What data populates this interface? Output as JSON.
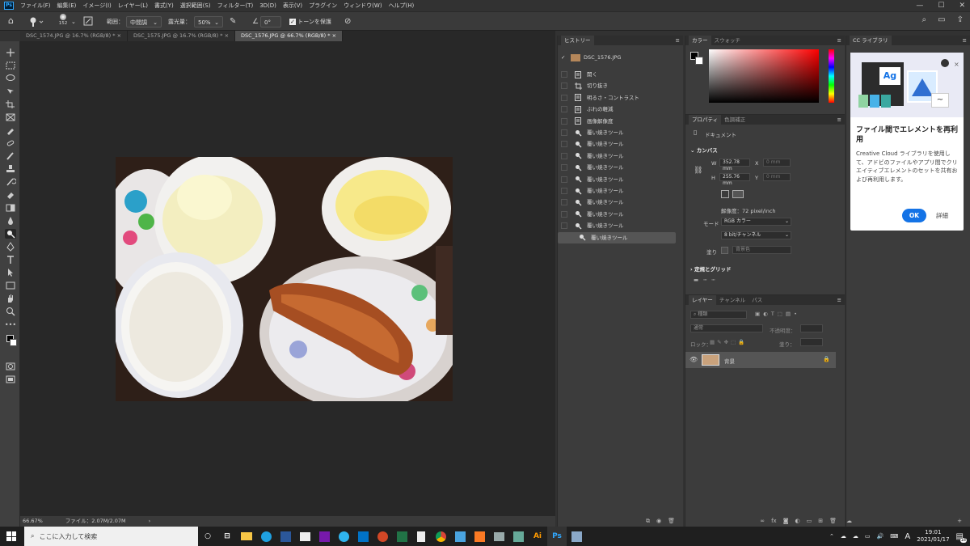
{
  "menubar": {
    "app_icon": "Ps",
    "items": [
      "ファイル(F)",
      "編集(E)",
      "イメージ(I)",
      "レイヤー(L)",
      "書式(Y)",
      "選択範囲(S)",
      "フィルター(T)",
      "3D(D)",
      "表示(V)",
      "プラグイン",
      "ウィンドウ(W)",
      "ヘルプ(H)"
    ],
    "window_controls": [
      "—",
      "☐",
      "✕"
    ]
  },
  "options_bar": {
    "brush_size": "152",
    "range_label": "範囲：",
    "range_value": "中間調",
    "exposure_label": "露光量：",
    "exposure_value": "50%",
    "angle_value": "0°",
    "protect_tones_label": "トーンを保護",
    "protect_tones_checked": true
  },
  "tabs": [
    {
      "label": "DSC_1574.JPG @ 16.7% (RGB/8) *",
      "active": false
    },
    {
      "label": "DSC_1575.JPG @ 16.7% (RGB/8) *",
      "active": false
    },
    {
      "label": "DSC_1576.JPG @ 66.7% (RGB/8) *",
      "active": true
    }
  ],
  "status_bar": {
    "zoom": "66.67%",
    "file": "ファイル：2.07M/2.07M",
    "arrow": "›"
  },
  "history": {
    "tab": "ヒストリー",
    "snapshot": "DSC_1576.JPG",
    "items": [
      {
        "label": "開く",
        "icon": "doc-icon"
      },
      {
        "label": "切り抜き",
        "icon": "crop-icon"
      },
      {
        "label": "明るさ・コントラスト",
        "icon": "doc-icon"
      },
      {
        "label": "ぶれの軽減",
        "icon": "doc-icon"
      },
      {
        "label": "画像解像度",
        "icon": "doc-icon"
      },
      {
        "label": "覆い焼きツール",
        "icon": "dodge-icon"
      },
      {
        "label": "覆い焼きツール",
        "icon": "dodge-icon"
      },
      {
        "label": "覆い焼きツール",
        "icon": "dodge-icon"
      },
      {
        "label": "覆い焼きツール",
        "icon": "dodge-icon"
      },
      {
        "label": "覆い焼きツール",
        "icon": "dodge-icon"
      },
      {
        "label": "覆い焼きツール",
        "icon": "dodge-icon"
      },
      {
        "label": "覆い焼きツール",
        "icon": "dodge-icon"
      },
      {
        "label": "覆い焼きツール",
        "icon": "dodge-icon"
      },
      {
        "label": "覆い焼きツール",
        "icon": "dodge-icon"
      },
      {
        "label": "覆い焼きツール",
        "icon": "dodge-icon"
      }
    ],
    "selected_index": 14
  },
  "color_panel": {
    "tab_color": "カラー",
    "tab_swatches": "スウォッチ",
    "hue": "#ff0000"
  },
  "properties": {
    "tab_properties": "プロパティ",
    "tab_adjust": "色調補正",
    "doc_label": "ドキュメント",
    "canvas_header": "カンバス",
    "w_label": "W",
    "w_value": "352.78 mm",
    "h_label": "H",
    "h_value": "255.76 mm",
    "x_label": "X",
    "x_value": "0 mm",
    "y_label": "Y",
    "y_value": "0 mm",
    "resolution": "解像度：72 pixel/inch",
    "mode_label": "モード",
    "mode_value": "RGB カラー",
    "depth_value": "8 bit/チャンネル",
    "fill_label": "塗り",
    "fill_value": "背景色",
    "rulers_header": "定規とグリッド"
  },
  "layers": {
    "tab_layers": "レイヤー",
    "tab_channels": "チャンネル",
    "tab_paths": "パス",
    "filter_label": "種類",
    "blend_mode": "通常",
    "opacity_label": "不透明度：",
    "lock_label": "ロック：",
    "fill_label": "塗り：",
    "layer_name": "背景"
  },
  "cc_library": {
    "tab": "CC ライブラリ",
    "title": "ファイル間でエレメントを再利用",
    "body": "Creative Cloud ライブラリを使用して、アドビのファイルやアプリ間でクリエイティブエレメントのセットを共有および再利用します。",
    "ok": "OK",
    "details": "詳細",
    "tile_text": "Ag",
    "accent": "#1473e6"
  },
  "taskbar": {
    "search_placeholder": "ここに入力して検索",
    "time": "19:01",
    "date": "2021/01/17",
    "ime": "A",
    "notif_count": "18"
  }
}
